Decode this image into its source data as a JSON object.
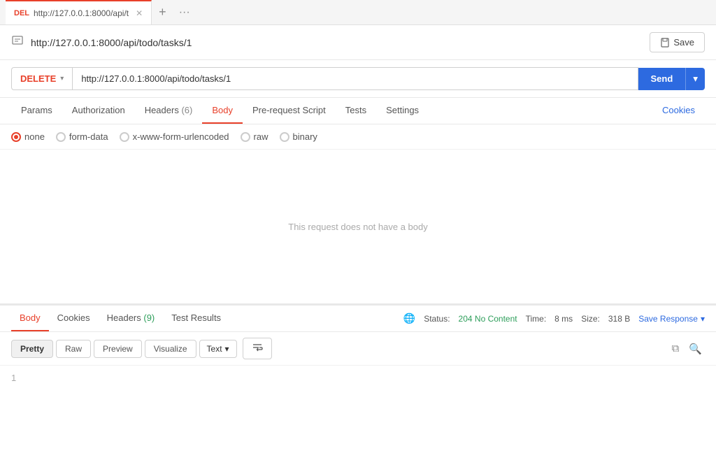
{
  "tab": {
    "method": "DEL",
    "url_short": "http://127.0.0.1:8000/api/t",
    "add_icon": "+",
    "more_icon": "···"
  },
  "address_bar": {
    "url": "http://127.0.0.1:8000/api/todo/tasks/1",
    "save_label": "Save"
  },
  "request": {
    "method": "DELETE",
    "url": "http://127.0.0.1:8000/api/todo/tasks/1",
    "send_label": "Send"
  },
  "tabs_nav": {
    "items": [
      {
        "label": "Params",
        "active": false,
        "badge": ""
      },
      {
        "label": "Authorization",
        "active": false,
        "badge": ""
      },
      {
        "label": "Headers",
        "active": false,
        "badge": " (6)"
      },
      {
        "label": "Body",
        "active": true,
        "badge": ""
      },
      {
        "label": "Pre-request Script",
        "active": false,
        "badge": ""
      },
      {
        "label": "Tests",
        "active": false,
        "badge": ""
      },
      {
        "label": "Settings",
        "active": false,
        "badge": ""
      }
    ],
    "cookies_label": "Cookies"
  },
  "body_options": {
    "options": [
      {
        "label": "none",
        "selected": true
      },
      {
        "label": "form-data",
        "selected": false
      },
      {
        "label": "x-www-form-urlencoded",
        "selected": false
      },
      {
        "label": "raw",
        "selected": false
      },
      {
        "label": "binary",
        "selected": false
      }
    ]
  },
  "body_content": {
    "empty_message": "This request does not have a body"
  },
  "response": {
    "tabs": [
      {
        "label": "Body",
        "active": true,
        "badge": ""
      },
      {
        "label": "Cookies",
        "active": false,
        "badge": ""
      },
      {
        "label": "Headers",
        "active": false,
        "badge": " (9)"
      },
      {
        "label": "Test Results",
        "active": false,
        "badge": ""
      }
    ],
    "status_label": "Status:",
    "status_value": "204 No Content",
    "time_label": "Time:",
    "time_value": "8 ms",
    "size_label": "Size:",
    "size_value": "318 B",
    "save_response_label": "Save Response",
    "format_tabs": [
      {
        "label": "Pretty",
        "active": true
      },
      {
        "label": "Raw",
        "active": false
      },
      {
        "label": "Preview",
        "active": false
      },
      {
        "label": "Visualize",
        "active": false
      }
    ],
    "format_select": "Text",
    "line_1": "1"
  }
}
